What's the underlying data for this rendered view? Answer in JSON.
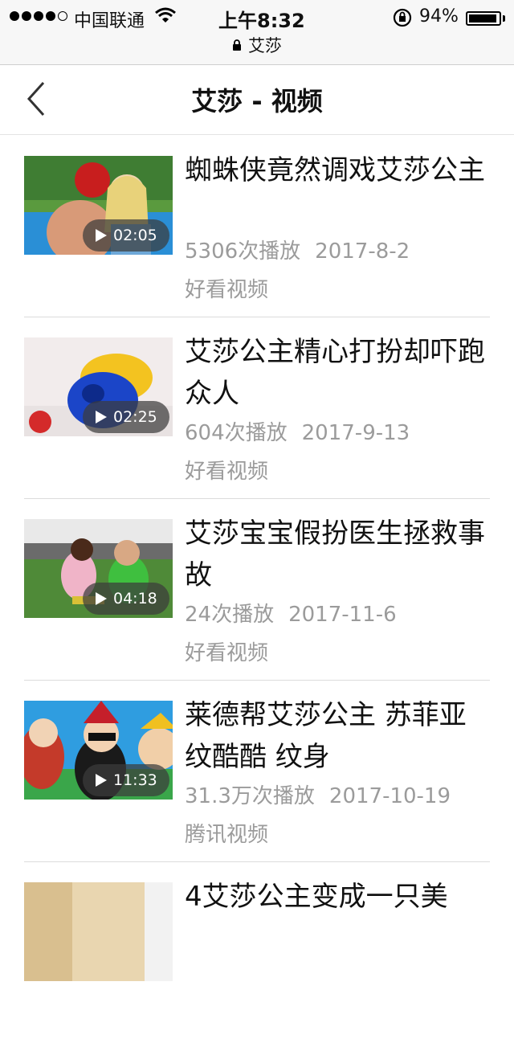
{
  "status_bar": {
    "carrier": "中国联通",
    "time": "上午8:32",
    "battery_percent": "94%",
    "battery_level": 0.94,
    "url": "艾莎",
    "icons": [
      "signal-dots-icon",
      "wifi-icon",
      "rotation-lock-icon",
      "battery-icon",
      "lock-icon"
    ]
  },
  "nav": {
    "title": "艾莎 - 视频",
    "back_icon": "chevron-left-icon"
  },
  "videos": [
    {
      "title": "蜘蛛侠竟然调戏艾莎公主",
      "duration": "02:05",
      "plays": "5306次播放",
      "date": "2017-8-2",
      "source": "好看视频"
    },
    {
      "title": "艾莎公主精心打扮却吓跑众人",
      "duration": "02:25",
      "plays": "604次播放",
      "date": "2017-9-13",
      "source": "好看视频"
    },
    {
      "title": "艾莎宝宝假扮医生拯救事故",
      "duration": "04:18",
      "plays": "24次播放",
      "date": "2017-11-6",
      "source": "好看视频"
    },
    {
      "title": "莱德帮艾莎公主 苏菲亚纹酷酷 纹身",
      "duration": "11:33",
      "plays": "31.3万次播放",
      "date": "2017-10-19",
      "source": "腾讯视频"
    },
    {
      "title": "4艾莎公主变成一只美"
    }
  ]
}
